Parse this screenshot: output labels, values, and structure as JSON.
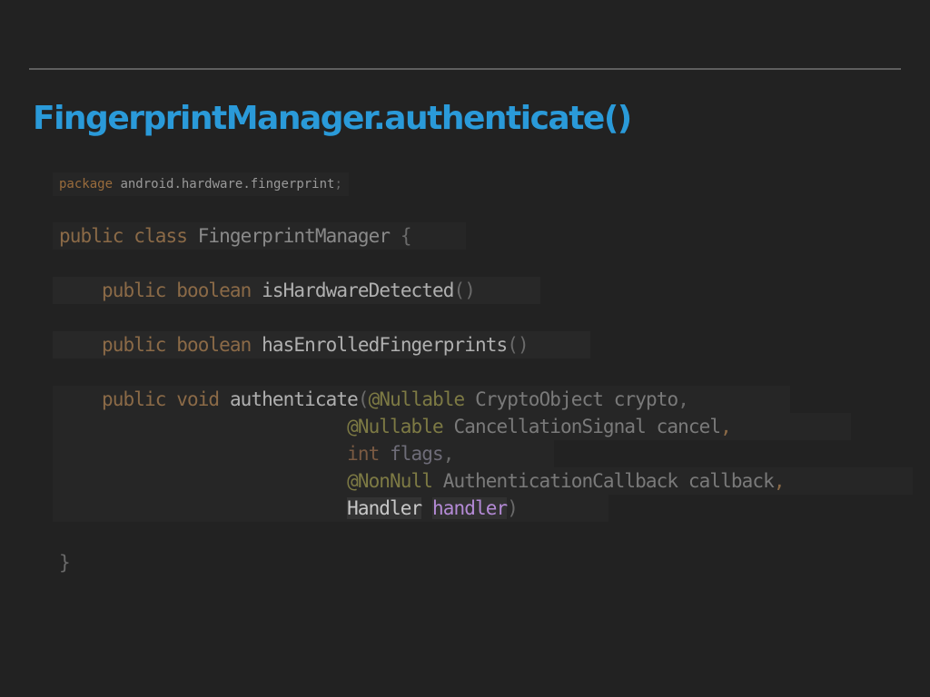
{
  "slide": {
    "title": "FingerprintManager.authenticate()"
  },
  "code": {
    "package_keyword": "package",
    "package_name": "android.hardware.fingerprint",
    "package_semicolon": ";",
    "public_kw": "public",
    "class_kw": "class",
    "class_name": "FingerprintManager",
    "open_brace": "{",
    "boolean_kw": "boolean",
    "void_kw": "void",
    "method1_name": "isHardwareDetected",
    "method2_name": "hasEnrolledFingerprints",
    "method3_name": "authenticate",
    "empty_parens": "()",
    "open_paren": "(",
    "close_paren": ")",
    "comma": ",",
    "nullable": "@Nullable",
    "nonnull": "@NonNull",
    "int_kw": "int",
    "param1_type": "CryptoObject",
    "param1_name": "crypto",
    "param2_type": "CancellationSignal",
    "param2_name": "cancel",
    "param3_name": "flags",
    "param4_type": "AuthenticationCallback",
    "param4_name": "callback",
    "param5_type": "Handler",
    "param5_name": "handler",
    "close_brace": "}"
  },
  "colors": {
    "background": "#222222",
    "title": "#2a9ad9",
    "keyword": "#8b6a47",
    "annotation": "#7d7a44",
    "highlight_variable": "#b48ad6"
  }
}
